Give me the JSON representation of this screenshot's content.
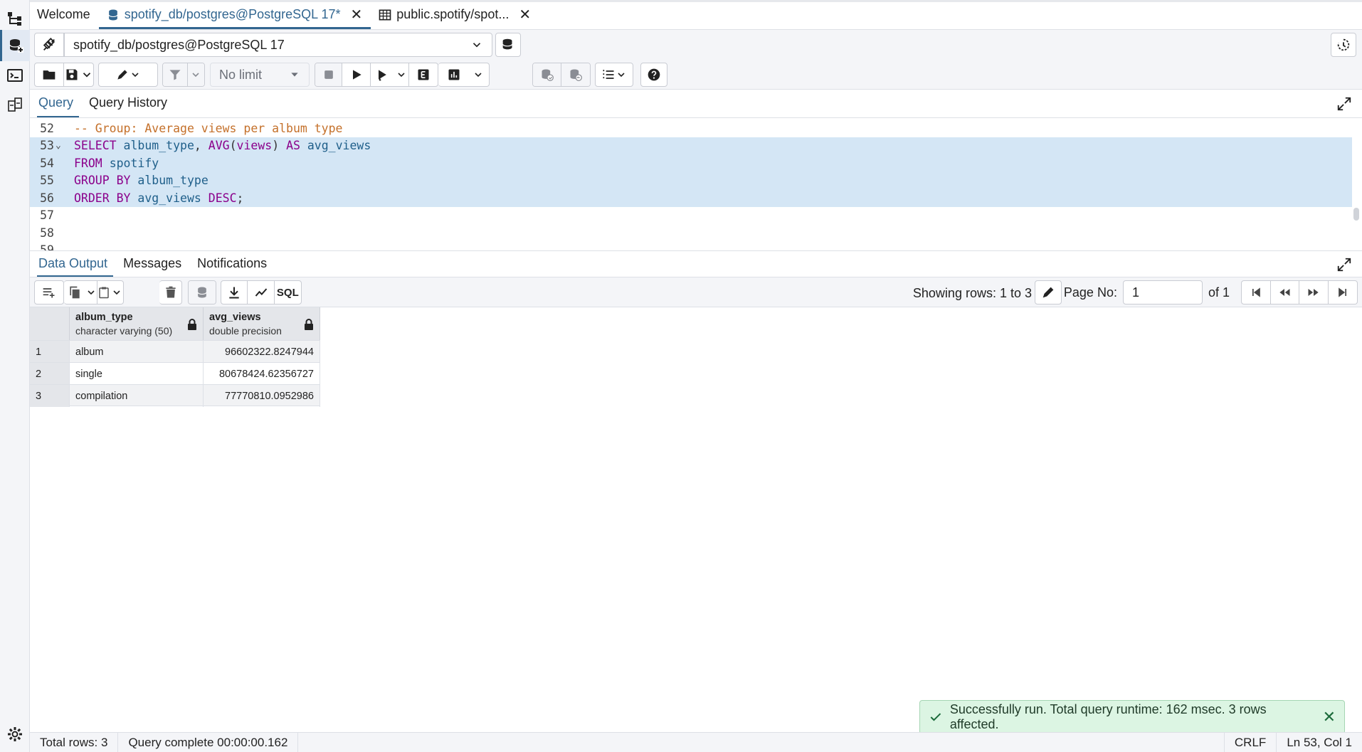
{
  "tabs": [
    {
      "label": "Welcome"
    },
    {
      "label": "spotify_db/postgres@PostgreSQL 17*"
    },
    {
      "label": "public.spotify/spot..."
    }
  ],
  "connection": {
    "label": "spotify_db/postgres@PostgreSQL 17"
  },
  "toolbar": {
    "limit_label": "No limit"
  },
  "query_tabs": {
    "query": "Query",
    "history": "Query History"
  },
  "editor": {
    "lines": [
      {
        "num": "52",
        "text": "-- Group: Average views per album type"
      },
      {
        "num": "53",
        "text": "SELECT album_type, AVG(views) AS avg_views"
      },
      {
        "num": "54",
        "text": "FROM spotify"
      },
      {
        "num": "55",
        "text": "GROUP BY album_type"
      },
      {
        "num": "56",
        "text": "ORDER BY avg_views DESC;"
      },
      {
        "num": "57",
        "text": ""
      },
      {
        "num": "58",
        "text": ""
      },
      {
        "num": "59",
        "text": ""
      }
    ]
  },
  "result_tabs": {
    "data": "Data Output",
    "messages": "Messages",
    "notifications": "Notifications"
  },
  "data_toolbar": {
    "sql_label": "SQL",
    "rows_info": "Showing rows: 1 to 3",
    "page_label": "Page No:",
    "page_value": "1",
    "page_total": "of 1"
  },
  "grid": {
    "columns": [
      {
        "name": "album_type",
        "type": "character varying (50)"
      },
      {
        "name": "avg_views",
        "type": "double precision"
      }
    ],
    "rows": [
      {
        "n": "1",
        "album_type": "album",
        "avg_views": "96602322.8247944"
      },
      {
        "n": "2",
        "album_type": "single",
        "avg_views": "80678424.62356727"
      },
      {
        "n": "3",
        "album_type": "compilation",
        "avg_views": "77770810.0952986"
      }
    ]
  },
  "toast": {
    "message": "Successfully run. Total query runtime: 162 msec. 3 rows affected."
  },
  "status": {
    "total_rows": "Total rows: 3",
    "query_complete": "Query complete 00:00:00.162",
    "line_ending": "CRLF",
    "cursor": "Ln 53, Col 1"
  },
  "colors": {
    "accent": "#326690",
    "selection": "#d4e6f5",
    "keyword": "#8b008b",
    "identifier": "#1f5f8a",
    "comment": "#c4702a",
    "toast_bg": "#dcf5e3"
  }
}
